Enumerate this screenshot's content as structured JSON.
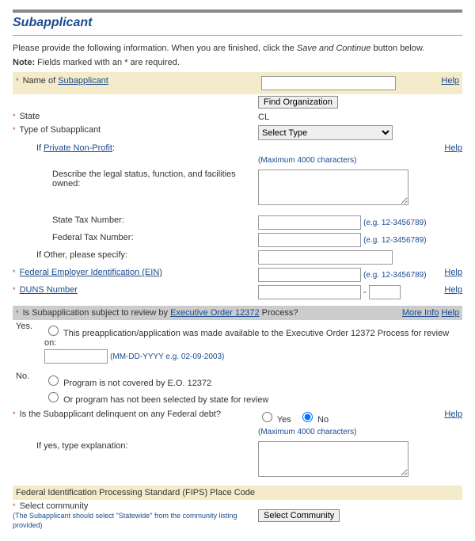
{
  "title": "Subapplicant",
  "intro_prefix": "Please provide the following information. When you are finished, click the ",
  "intro_button_ref": "Save and Continue",
  "intro_suffix": " button below.",
  "note_label": "Note:",
  "note_text": " Fields marked with an * are required.",
  "help_label": "Help",
  "more_info_label": "More Info",
  "fields": {
    "name_prefix": "Name of ",
    "subapplicant_link": "Subapplicant",
    "find_org_btn": "Find Organization",
    "state_label": "State",
    "state_value": "CL",
    "type_label": "Type of Subapplicant",
    "type_selected": "Select Type",
    "if_prefix": "If ",
    "pnp_link": "Private Non-Profit",
    "pnp_colon": ":",
    "describe_label": "Describe the legal status, function, and facilities owned:",
    "max4000": "(Maximum 4000 characters)",
    "state_tax_label": "State Tax Number:",
    "fed_tax_label": "Federal Tax Number:",
    "tax_hint": "(e.g. 12-3456789)",
    "if_other_label": "If Other, please specify:",
    "fein_link": "Federal Employer Identification (EIN)",
    "duns_link": "DUNS Number",
    "eo_prefix": "Is Subapplication subject to review by ",
    "eo_link": "Executive Order 12372",
    "eo_suffix": " Process?",
    "yes": "Yes.",
    "yes_word": "Yes",
    "no": "No.",
    "no_word": "No",
    "yes_text": "This preapplication/application was made available to the Executive Order 12372 Process for review on:",
    "date_hint": "(MM-DD-YYYY e.g. 02-09-2003)",
    "no_text1": "Program is not covered by E.O. 12372",
    "no_text2": "Or program has not been selected by state for review",
    "delinquent_label": "Is the Subapplicant delinquent on any Federal debt?",
    "if_yes_label": "If yes, type explanation:",
    "fips_header": "Federal Identification Processing Standard (FIPS) Place Code",
    "select_community_label": "Select community",
    "select_community_note": "(The Subapplicant should select \"Statewide\" from the community listing provided)",
    "select_community_btn": "Select Community"
  }
}
